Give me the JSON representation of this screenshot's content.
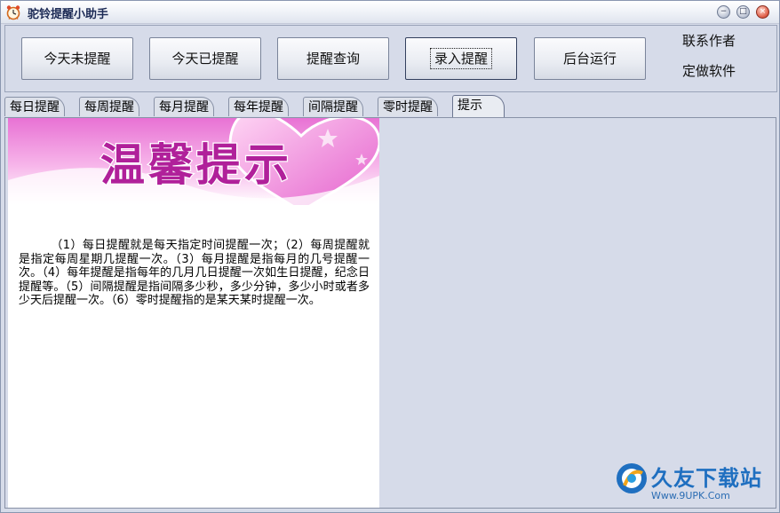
{
  "window": {
    "title": "驼铃提醒小助手",
    "controls": {
      "minimize": "−",
      "maximize": "□",
      "close": "×"
    }
  },
  "toolbar": {
    "buttons": [
      {
        "label": "今天未提醒"
      },
      {
        "label": "今天已提醒"
      },
      {
        "label": "提醒查询"
      },
      {
        "label": "录入提醒"
      },
      {
        "label": "后台运行"
      }
    ],
    "links": [
      {
        "label": "联系作者"
      },
      {
        "label": "定做软件"
      }
    ]
  },
  "tabs": [
    {
      "label": "每日提醒"
    },
    {
      "label": "每周提醒"
    },
    {
      "label": "每月提醒"
    },
    {
      "label": "每年提醒"
    },
    {
      "label": "间隔提醒"
    },
    {
      "label": "零时提醒"
    },
    {
      "label": "提示",
      "active": true
    }
  ],
  "tip": {
    "banner_text": "温馨提示",
    "body": "（1）每日提醒就是每天指定时间提醒一次；（2）每周提醒就是指定每周星期几提醒一次。（3）每月提醒是指每月的几号提醒一次。（4）每年提醒是指每年的几月几日提醒一次如生日提醒，纪念日提醒等。（5）间隔提醒是指间隔多少秒，多少分钟，多少小时或者多少天后提醒一次。（6）零时提醒指的是某天某时提醒一次。"
  },
  "watermark": {
    "name": "久友下载站",
    "url": "Www.9UPK.Com"
  },
  "colors": {
    "window_bg": "#d6dbe9",
    "banner_pink": "#e05ac8",
    "banner_magenta": "#b0209a",
    "watermark_blue": "#1f6fc0"
  }
}
